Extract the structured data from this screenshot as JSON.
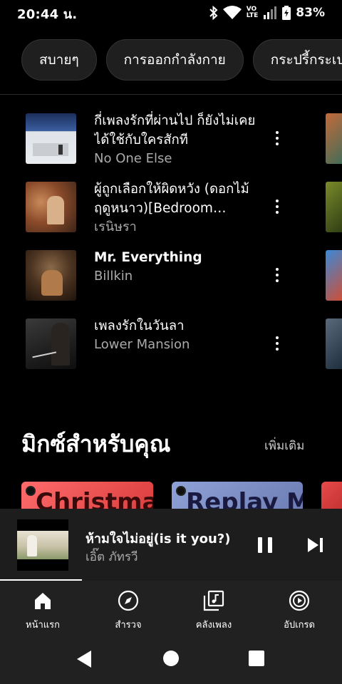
{
  "status_bar": {
    "time": "20:44 น.",
    "volte_top": "VO",
    "volte_bottom": "LTE",
    "network": "4G",
    "battery_percent": "83%"
  },
  "chips": [
    {
      "label": "สบายๆ"
    },
    {
      "label": "การออกกำลังกาย"
    },
    {
      "label": "กระปรี้กระเปร่า"
    }
  ],
  "songs": [
    {
      "title": "กี่เพลงรักที่ผ่านไป ก็ยังไม่เคยได้ใช้กับใครสักที",
      "artist": "No One Else",
      "title_bold": false
    },
    {
      "title": "ผู้ถูกเลือกให้ผิดหวัง (ดอกไม้ฤดูหนาว)[Bedroom version]",
      "artist": "เรนิษรา",
      "title_bold": false
    },
    {
      "title": "Mr. Everything",
      "artist": "Billkin",
      "title_bold": true
    },
    {
      "title": "เพลงรักในวันลา",
      "artist": "Lower Mansion",
      "title_bold": false
    }
  ],
  "mixes_section": {
    "title": "มิกซ์สำหรับคุณ",
    "more_label": "เพิ่มเติม",
    "cards": [
      {
        "label": "Christmas",
        "color": "#e84a4a"
      },
      {
        "label": "Replay Mix",
        "color": "#7d8fc4"
      }
    ]
  },
  "mini_player": {
    "title": "ห้ามใจไม่อยู่(is it you?)",
    "artist": "เอิ๊ต ภัทรวี",
    "progress": 0.24
  },
  "bottom_nav": [
    {
      "label": "หน้าแรก",
      "icon": "home-icon",
      "active": true
    },
    {
      "label": "สำรวจ",
      "icon": "compass-icon",
      "active": false
    },
    {
      "label": "คลังเพลง",
      "icon": "library-icon",
      "active": false
    },
    {
      "label": "อัปเกรด",
      "icon": "upgrade-icon",
      "active": false
    }
  ]
}
